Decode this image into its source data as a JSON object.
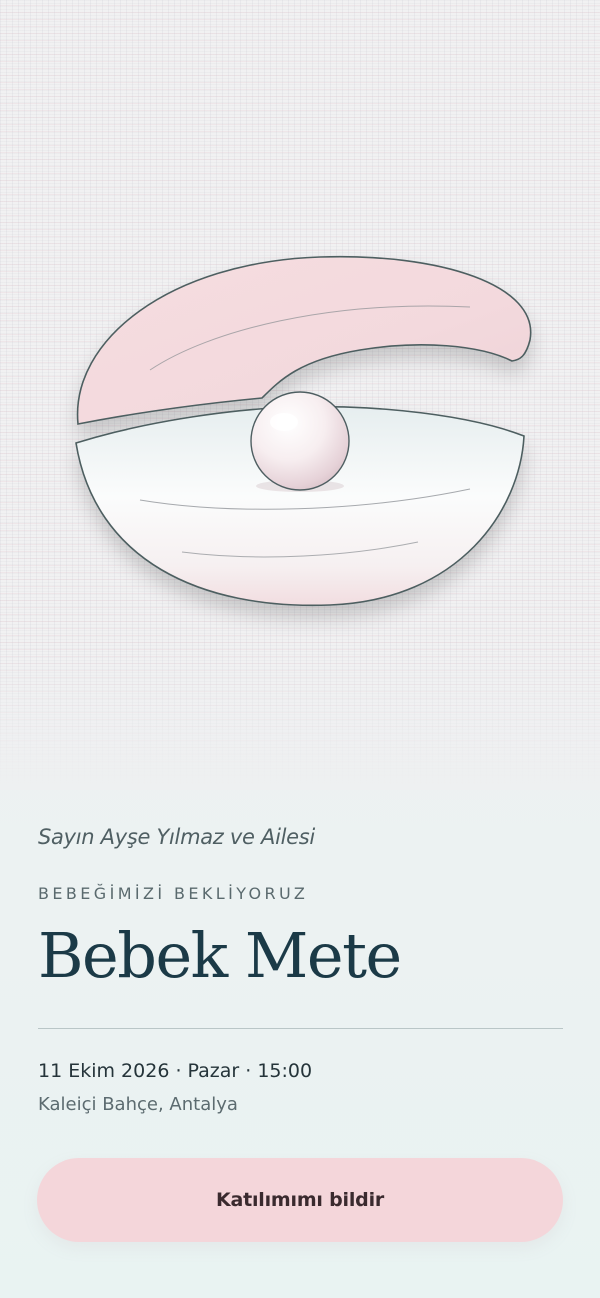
{
  "invitation": {
    "salutation": "Sayın Ayşe Yılmaz ve Ailesi",
    "eyebrow": "BEBEĞİMİZİ BEKLİYORUZ",
    "name": "Bebek Mete",
    "datetime": "11 Ekim 2026 · Pazar · 15:00",
    "venue": "Kaleiçi Bahçe, Antalya"
  },
  "rsvp": {
    "label": "Katılımımı bildir"
  },
  "illustration": {
    "subject": "pearl-in-oyster-shell-illustration"
  },
  "colors": {
    "accent_pink": "#f4d6da",
    "title_navy": "#1b3a47",
    "shell_outline": "#4e5e61"
  }
}
